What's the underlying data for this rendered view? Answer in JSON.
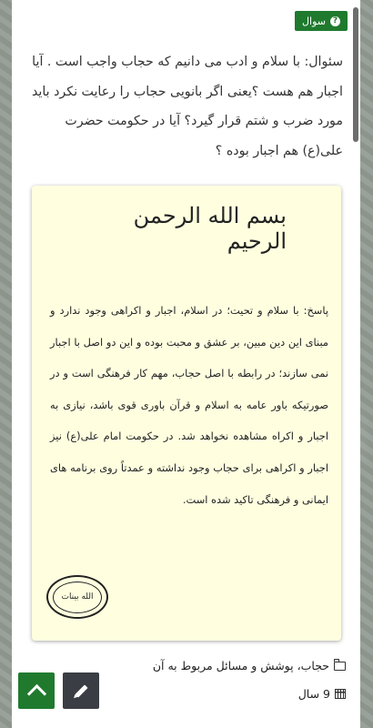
{
  "tag": {
    "label": "سوال",
    "icon": "question-circle-icon"
  },
  "question": {
    "text": "سئوال: با سلام و ادب می دانیم که حجاب واجب است . آیا اجبار هم هست ؟یعنی اگر بانویی حجاب را رعایت نکرد باید مورد ضرب و شتم قرار گیرد؟ آیا در حکومت حضرت علی(ع) هم اجبار بوده ؟"
  },
  "answer": {
    "bismillah": "بسم الله الرحمن الرحيم",
    "text": "پاسخ: با سلام و تحیت؛ در اسلام، اجبار و اکراهی وجود ندارد و مبنای این دین مبین، بر عشق و محبت بوده و این دو اصل با اجبار نمی سازند؛ در رابطه با اصل حجاب، مهم کار فرهنگی است و در صورتیکه باور عامه به اسلام و قرآن باوری قوی باشد، نیازی به اجبار و اکراه مشاهده نخواهد شد. در حکومت امام علی(ع) نیز اجبار و اکراهی برای حجاب وجود نداشته و عمدتاً روی برنامه های ایمانی و فرهنگی تاکید شده است.",
    "seal_text": "الله بینات"
  },
  "meta": {
    "category": "حجاب، پوشش و مسائل مربوط به آن",
    "category_icon": "folder-icon",
    "age": "9 سال",
    "age_icon": "calendar-icon"
  },
  "buttons": {
    "scroll_top_icon": "chevron-up-icon",
    "edit_icon": "pencil-icon"
  },
  "colors": {
    "accent_green": "#1f7a2e",
    "answer_bg": "#ffffe0",
    "dark_button": "#3a3d44"
  }
}
